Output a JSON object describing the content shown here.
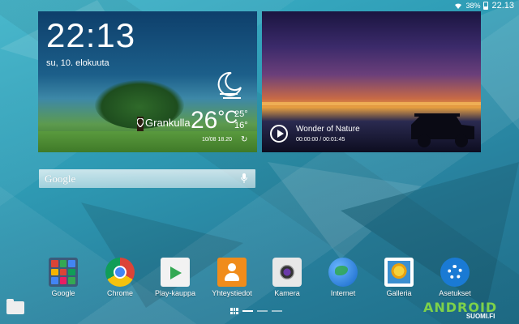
{
  "status_bar": {
    "battery": "38%",
    "time": "22.13",
    "wifi_icon": "wifi-icon",
    "battery_icon": "battery-icon"
  },
  "weather_widget": {
    "time": "22:13",
    "date": "su, 10. elokuuta",
    "location": "Grankulla",
    "temperature": "26",
    "unit": "°C",
    "high": "25°",
    "low": "16°",
    "updated": "10/08 18.20",
    "weather_icon": "moon-icon"
  },
  "video_widget": {
    "title": "Wonder of Nature",
    "time": "00:00:00 / 00:01:45"
  },
  "google_search": {
    "logo": "Google"
  },
  "apps": [
    {
      "label": "Google"
    },
    {
      "label": "Chrome"
    },
    {
      "label": "Play-kauppa"
    },
    {
      "label": "Yhteystiedot"
    },
    {
      "label": "Kamera"
    },
    {
      "label": "Internet"
    },
    {
      "label": "Galleria"
    },
    {
      "label": "Asetukset"
    }
  ],
  "watermark": {
    "brand": "ANDROID",
    "site": "SUOMI.FI"
  }
}
